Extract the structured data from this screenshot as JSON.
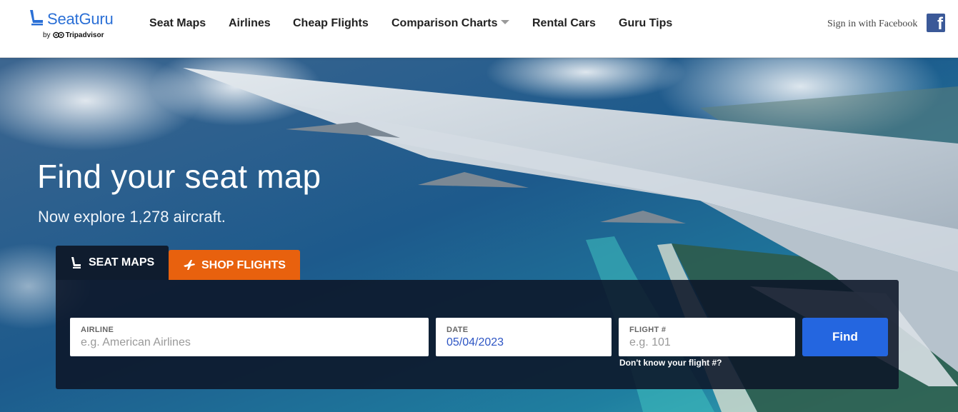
{
  "header": {
    "brand": {
      "name": "SeatGuru",
      "byline_prefix": "by",
      "byline_company": "Tripadvisor"
    },
    "nav": [
      {
        "label": "Seat Maps"
      },
      {
        "label": "Airlines"
      },
      {
        "label": "Cheap Flights"
      },
      {
        "label": "Comparison Charts",
        "has_dropdown": true
      },
      {
        "label": "Rental Cars"
      },
      {
        "label": "Guru Tips"
      }
    ],
    "signin_label": "Sign in with Facebook",
    "facebook_icon": "facebook-icon"
  },
  "hero": {
    "headline": "Find your seat map",
    "subheadline": "Now explore 1,278 aircraft."
  },
  "search": {
    "tabs": [
      {
        "label": "SEAT MAPS",
        "icon": "seat-icon",
        "active": true
      },
      {
        "label": "SHOP FLIGHTS",
        "icon": "airplane-icon",
        "active": false
      }
    ],
    "airline": {
      "label": "AIRLINE",
      "placeholder": "e.g. American Airlines",
      "value": ""
    },
    "date": {
      "label": "DATE",
      "value": "05/04/2023"
    },
    "flight": {
      "label": "FLIGHT #",
      "placeholder": "e.g. 101",
      "value": ""
    },
    "find_label": "Find",
    "help_link": "Don't know your flight #?"
  },
  "colors": {
    "brand_blue": "#2a6fd6",
    "find_button": "#2466e0",
    "shop_tab": "#e8610e",
    "panel": "#0c1628",
    "facebook": "#3b5998"
  }
}
